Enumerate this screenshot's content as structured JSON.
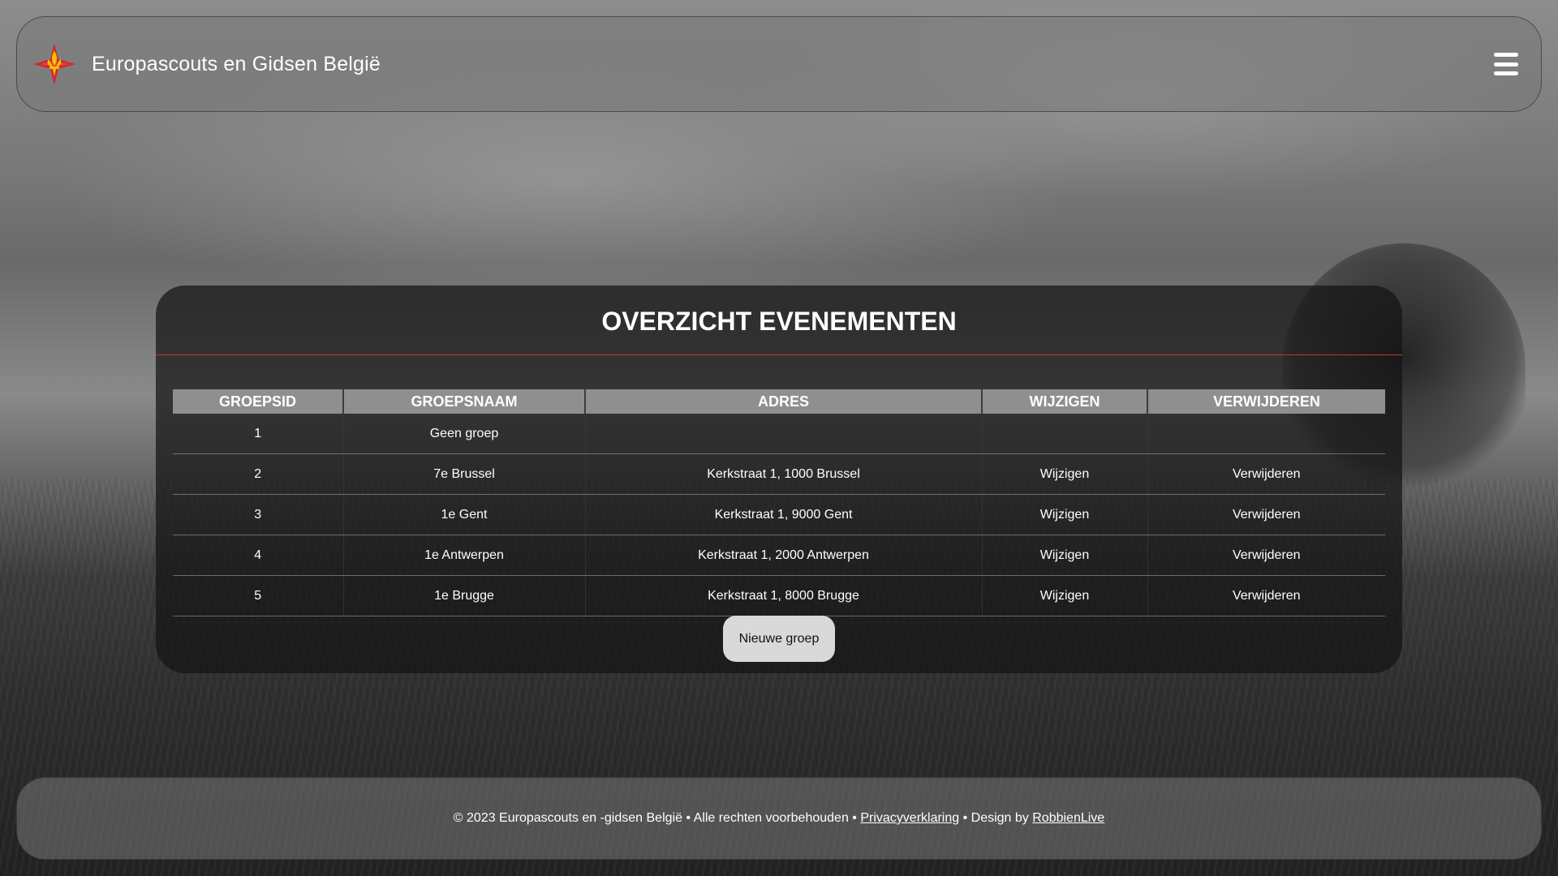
{
  "header": {
    "brand": "Europascouts en Gidsen België"
  },
  "main": {
    "title": "OVERZICHT EVENEMENTEN",
    "columns": [
      "GROEPSID",
      "GROEPSNAAM",
      "ADRES",
      "WIJZIGEN",
      "VERWIJDEREN"
    ],
    "rows": [
      {
        "id": "1",
        "name": "Geen groep",
        "address": "",
        "edit": "",
        "delete": ""
      },
      {
        "id": "2",
        "name": "7e Brussel",
        "address": "Kerkstraat 1, 1000 Brussel",
        "edit": "Wijzigen",
        "delete": "Verwijderen"
      },
      {
        "id": "3",
        "name": "1e Gent",
        "address": "Kerkstraat 1, 9000 Gent",
        "edit": "Wijzigen",
        "delete": "Verwijderen"
      },
      {
        "id": "4",
        "name": "1e Antwerpen",
        "address": "Kerkstraat 1, 2000 Antwerpen",
        "edit": "Wijzigen",
        "delete": "Verwijderen"
      },
      {
        "id": "5",
        "name": "1e Brugge",
        "address": "Kerkstraat 1, 8000 Brugge",
        "edit": "Wijzigen",
        "delete": "Verwijderen"
      }
    ],
    "new_button": "Nieuwe groep"
  },
  "footer": {
    "copyright": "© 2023 Europascouts en -gidsen België • Alle rechten voorbehouden • ",
    "privacy_link": "Privacyverklaring",
    "design_prefix": " • Design by ",
    "designer_link": "RobbienLive"
  },
  "colors": {
    "accent_line": "#c0392b",
    "logo_red": "#d62828",
    "logo_gold": "#f2c200"
  },
  "icons": {
    "logo": "scout-lily-star-icon",
    "menu": "hamburger-menu-icon"
  }
}
